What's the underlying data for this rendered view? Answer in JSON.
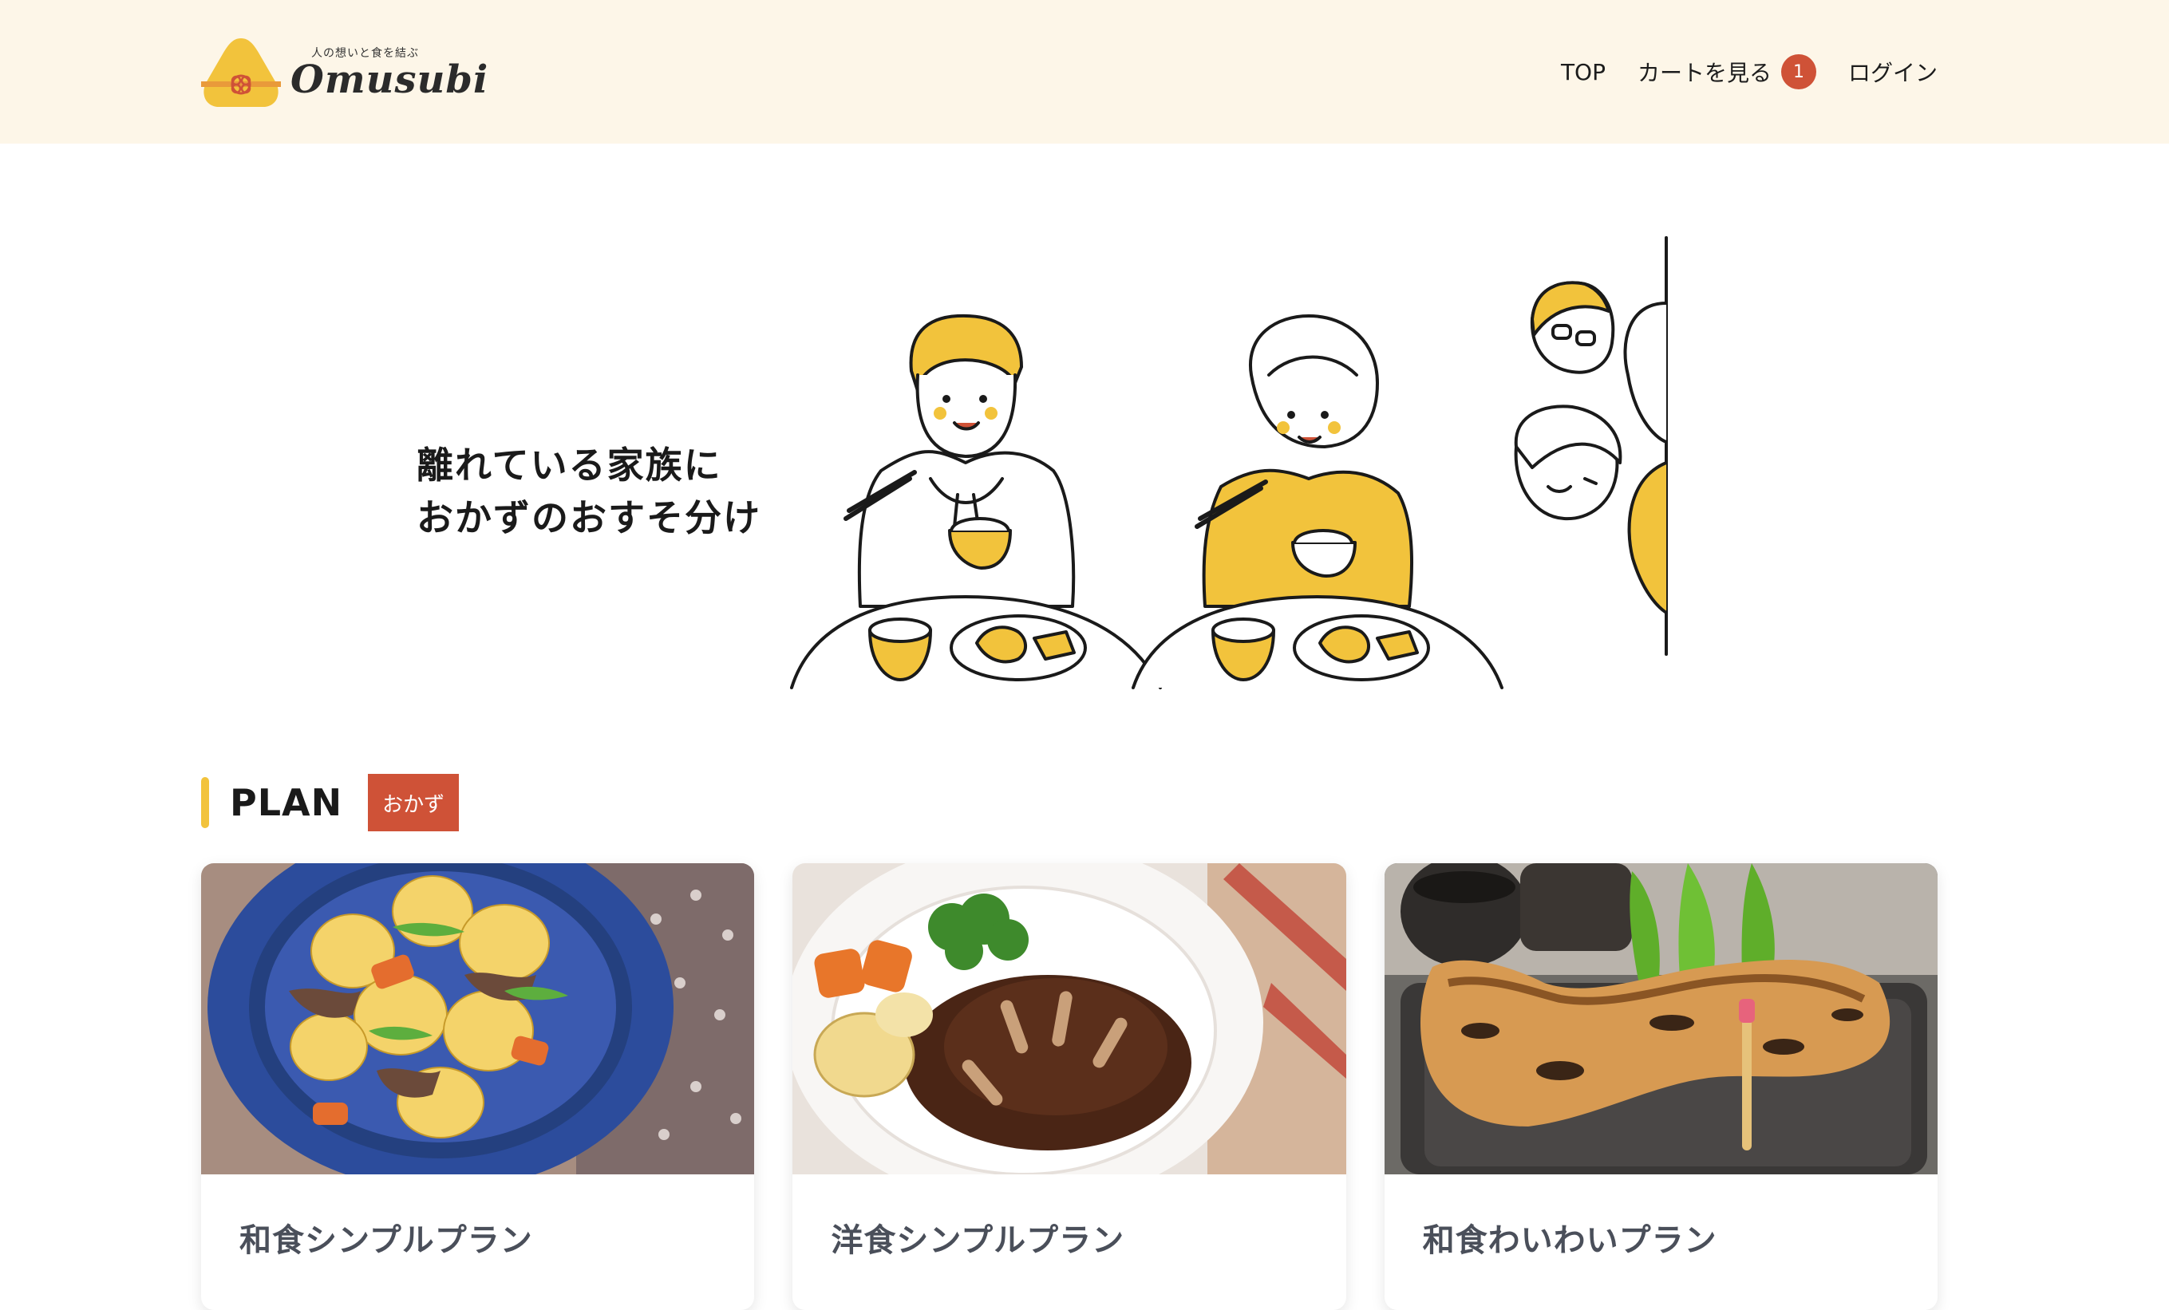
{
  "header": {
    "logo": {
      "tagline": "人の想いと食を結ぶ",
      "wordmark": "Omusubi",
      "icon": "onigiri-logo-icon"
    },
    "nav": {
      "top": "TOP",
      "cart": "カートを見る",
      "cart_count": "1",
      "login": "ログイン"
    }
  },
  "hero": {
    "line1": "離れている家族に",
    "line2": "おかずのおすそ分け",
    "illustration": "family-eating-illustration"
  },
  "plan_section": {
    "title": "PLAN",
    "tag": "おかず"
  },
  "plans": [
    {
      "title": "和食シンプルプラン",
      "image": "nikujaga-photo"
    },
    {
      "title": "洋食シンプルプラン",
      "image": "hamburg-steak-photo"
    },
    {
      "title": "和食わいわいプラン",
      "image": "grilled-fish-collar-photo"
    }
  ],
  "colors": {
    "header_bg": "#fdf6e8",
    "accent_yellow": "#f2c33c",
    "accent_red": "#cf5237",
    "card_title": "#4a4f5a"
  }
}
